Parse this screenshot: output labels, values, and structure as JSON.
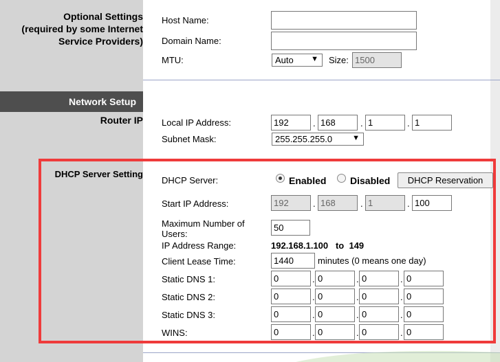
{
  "sidebar": {
    "optional_title_line1": "Optional Settings",
    "optional_title_line2": "(required by some Internet",
    "optional_title_line3": "Service Providers)",
    "network_setup": "Network Setup",
    "router_ip": "Router IP",
    "dhcp_server_setting": "DHCP Server Setting"
  },
  "optional": {
    "host_name_label": "Host Name:",
    "host_name_value": "",
    "domain_name_label": "Domain Name:",
    "domain_name_value": "",
    "mtu_label": "MTU:",
    "mtu_selected": "Auto",
    "size_label": "Size:",
    "size_value": "1500"
  },
  "router": {
    "local_ip_label": "Local IP Address:",
    "ip": [
      "192",
      "168",
      "1",
      "1"
    ],
    "subnet_label": "Subnet Mask:",
    "subnet_selected": "255.255.255.0"
  },
  "dhcp": {
    "server_label": "DHCP Server:",
    "enabled_label": "Enabled",
    "disabled_label": "Disabled",
    "server_state": "Enabled",
    "reservation_button": "DHCP Reservation",
    "start_ip_label": "Start IP Address:",
    "start_ip": [
      "192",
      "168",
      "1",
      "100"
    ],
    "max_users_label_line1": "Maximum Number of",
    "max_users_label_line2": "Users:",
    "max_users_value": "50",
    "range_label": "IP Address Range:",
    "range_value": "192.168.1.100   to  149",
    "lease_label": "Client Lease Time:",
    "lease_value": "1440",
    "lease_note": "minutes (0 means one day)",
    "dns1_label": "Static DNS 1:",
    "dns1": [
      "0",
      "0",
      "0",
      "0"
    ],
    "dns2_label": "Static DNS 2:",
    "dns2": [
      "0",
      "0",
      "0",
      "0"
    ],
    "dns3_label": "Static DNS 3:",
    "dns3": [
      "0",
      "0",
      "0",
      "0"
    ],
    "wins_label": "WINS:",
    "wins": [
      "0",
      "0",
      "0",
      "0"
    ]
  },
  "colors": {
    "highlight": "#ef3b3b",
    "network_bar": "#4e4e4e",
    "sidebar": "#d4d4d4"
  }
}
